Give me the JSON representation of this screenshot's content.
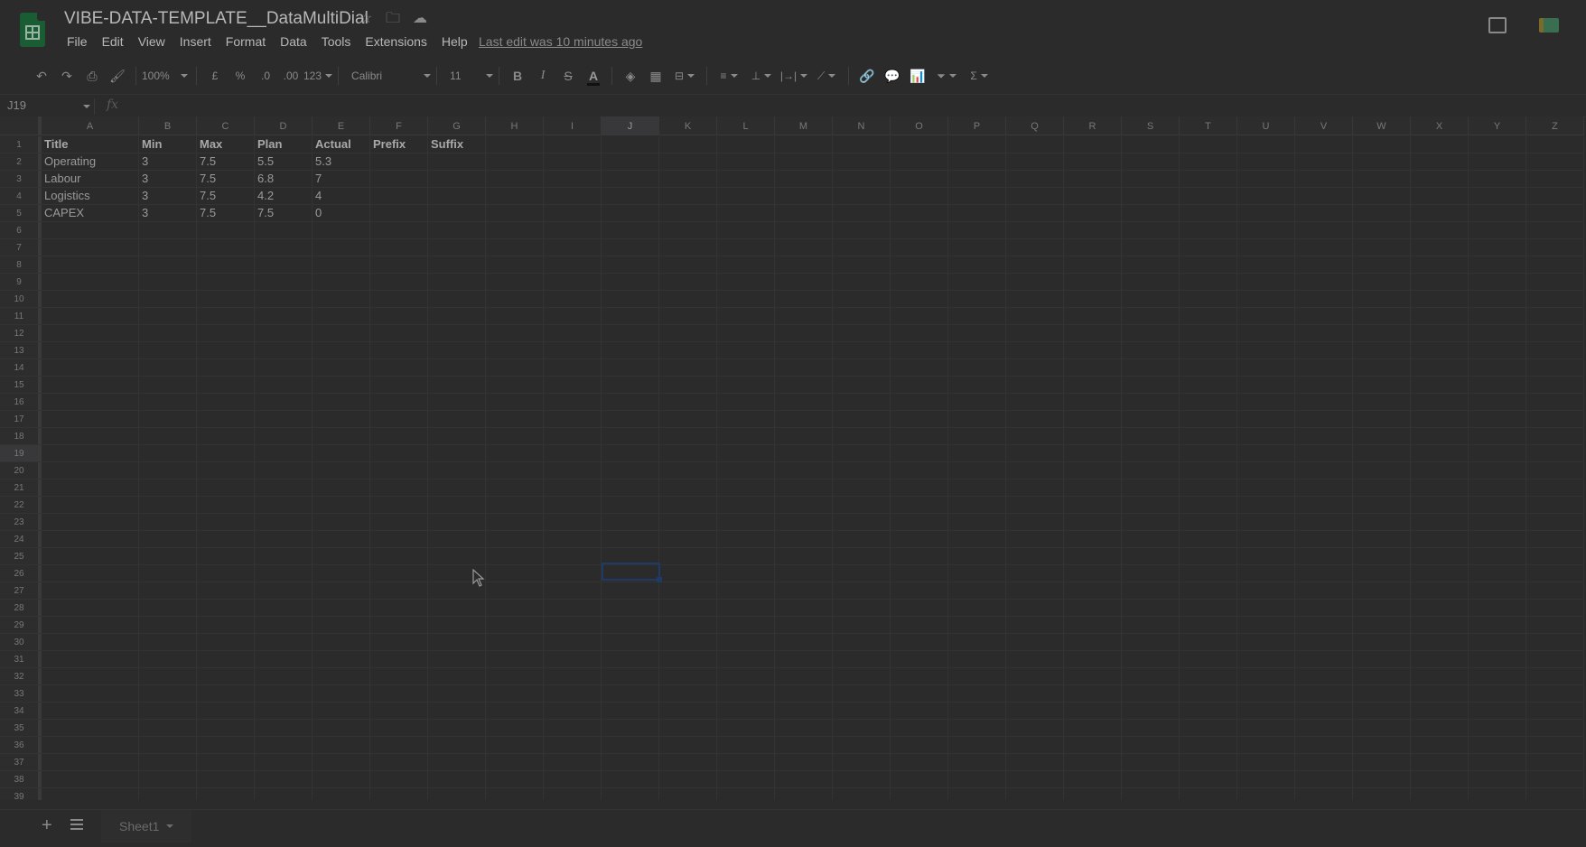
{
  "title_bar": {
    "doc_title": "VIBE-DATA-TEMPLATE__DataMultiDial",
    "last_edit": "Last edit was 10 minutes ago"
  },
  "menu": [
    "File",
    "Edit",
    "View",
    "Insert",
    "Format",
    "Data",
    "Tools",
    "Extensions",
    "Help"
  ],
  "toolbar": {
    "zoom": "100%",
    "currency": "£",
    "percent": "%",
    "decimal_decrease": ".0",
    "decimal_increase": ".00",
    "more_formats": "123",
    "font": "Calibri",
    "font_size": "11",
    "bold": "B",
    "italic": "I",
    "strikethrough": "S",
    "text_color": "A",
    "sum": "Σ"
  },
  "formula_bar": {
    "name_box": "J19",
    "fx": "fx"
  },
  "columns": [
    "A",
    "B",
    "C",
    "D",
    "E",
    "F",
    "G",
    "H",
    "I",
    "J",
    "K",
    "L",
    "M",
    "N",
    "O",
    "P",
    "Q",
    "R",
    "S",
    "T",
    "U",
    "V",
    "W",
    "X",
    "Y",
    "Z"
  ],
  "selected_column": "J",
  "selected_row": "19",
  "rows": [
    [
      "Title",
      "Min",
      "Max",
      "Plan",
      "Actual",
      "Prefix",
      "Suffix"
    ],
    [
      "Operating",
      "3",
      "7.5",
      "5.5",
      "5.3"
    ],
    [
      "Labour",
      "3",
      "7.5",
      "6.8",
      "7"
    ],
    [
      "Logistics",
      "3",
      "7.5",
      "4.2",
      "4"
    ],
    [
      "CAPEX",
      "3",
      "7.5",
      "7.5",
      "0"
    ]
  ],
  "row_count": 39,
  "sheets": [
    "Sheet1"
  ]
}
